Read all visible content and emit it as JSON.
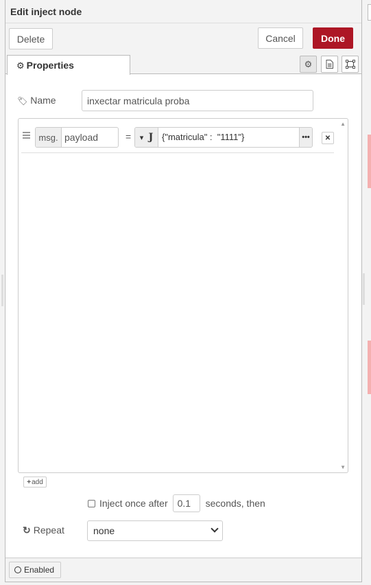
{
  "header": {
    "title": "Edit inject node"
  },
  "toolbar": {
    "delete_label": "Delete",
    "cancel_label": "Cancel",
    "done_label": "Done"
  },
  "tabs": {
    "properties_label": "Properties"
  },
  "form": {
    "name_label": "Name",
    "name_value": "inxectar matricula proba",
    "properties": [
      {
        "prefix": "msg.",
        "property": "payload",
        "operator": "=",
        "type_icon": "json-icon",
        "value": "{\"matricula\" :  \"1111\"}"
      }
    ],
    "add_label": "add",
    "inject_once_label": "Inject once after",
    "inject_once_checked": false,
    "inject_delay": "0.1",
    "seconds_label": "seconds, then",
    "repeat_label": "Repeat",
    "repeat_value": "none"
  },
  "footer": {
    "enabled_label": "Enabled"
  },
  "colors": {
    "done_button": "#ad1625",
    "accent_pink": "#f5b0b0"
  }
}
